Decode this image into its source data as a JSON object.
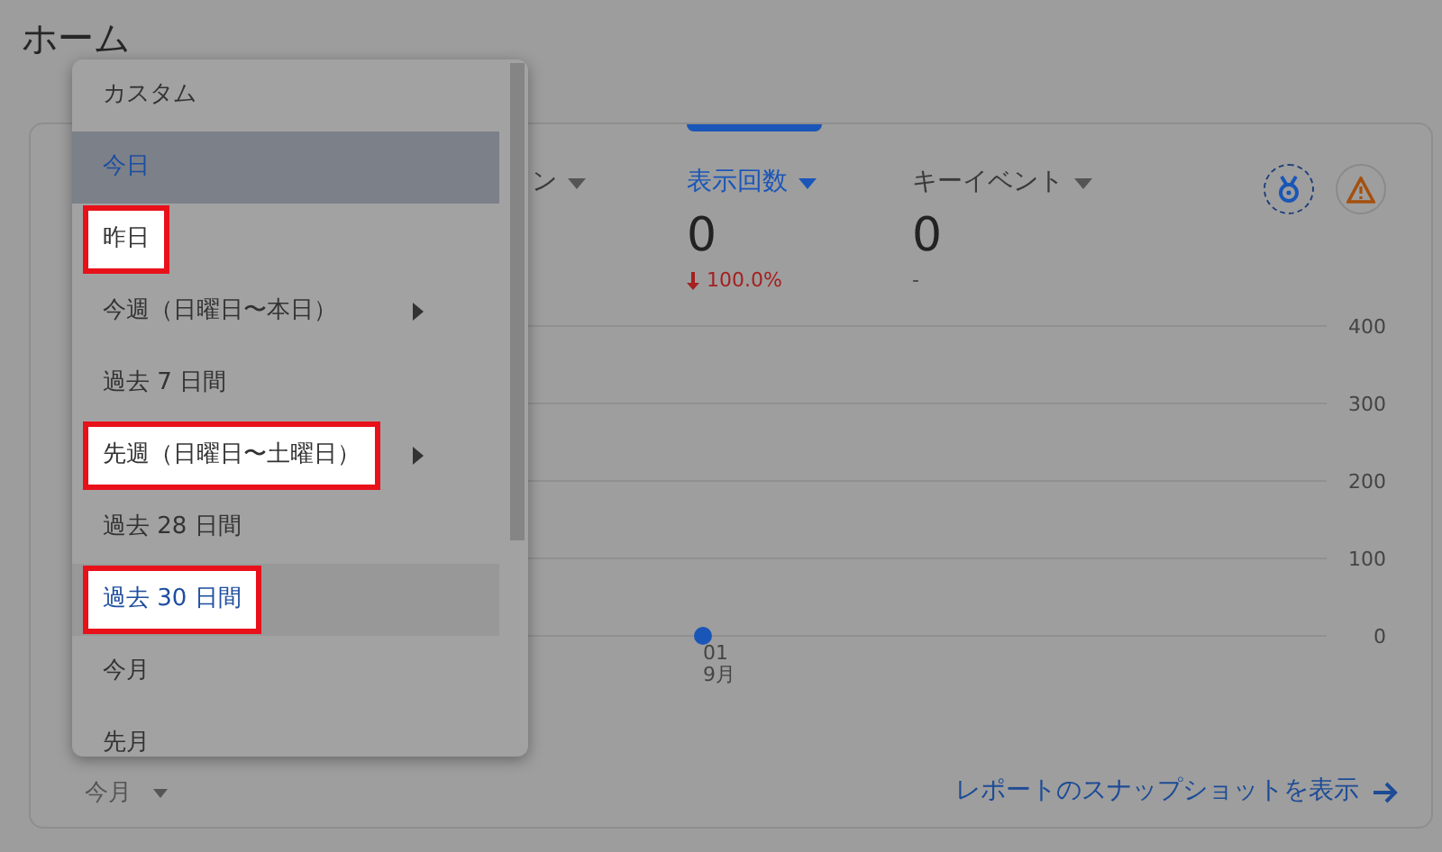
{
  "page": {
    "title": "ホーム"
  },
  "metrics": [
    {
      "label": "ン",
      "selected": false
    },
    {
      "label": "表示回数",
      "selected": true,
      "value": "0",
      "change": "100.0%",
      "decreased": true
    },
    {
      "label": "キーイベント",
      "selected": false,
      "value": "0",
      "change": "-",
      "decreased": false
    }
  ],
  "chart_data": {
    "type": "line",
    "categories": [
      "01\n9月"
    ],
    "series": [
      {
        "color": "#1a56b8",
        "marker": "circle",
        "values": [
          0
        ]
      }
    ],
    "ylim": [
      0,
      400
    ],
    "yticks": [
      400,
      300,
      200,
      100,
      0
    ],
    "grid": true
  },
  "period_select": {
    "value": "今月"
  },
  "report_link": {
    "label": "レポートのスナップショットを表示"
  },
  "menu": {
    "items": [
      {
        "label": "カスタム",
        "selected": false,
        "hovered": false,
        "highlighted": false,
        "submenu": false
      },
      {
        "label": "今日",
        "selected": true,
        "hovered": false,
        "highlighted": false,
        "submenu": false
      },
      {
        "label": "昨日",
        "selected": false,
        "hovered": false,
        "highlighted": true,
        "submenu": false
      },
      {
        "label": "今週（日曜日〜本日）",
        "selected": false,
        "hovered": false,
        "highlighted": false,
        "submenu": true
      },
      {
        "label": "過去 7 日間",
        "selected": false,
        "hovered": false,
        "highlighted": false,
        "submenu": false
      },
      {
        "label": "先週（日曜日〜土曜日）",
        "selected": false,
        "hovered": false,
        "highlighted": true,
        "submenu": true
      },
      {
        "label": "過去 28 日間",
        "selected": false,
        "hovered": false,
        "highlighted": false,
        "submenu": false
      },
      {
        "label": "過去 30 日間",
        "selected": false,
        "hovered": true,
        "highlighted": true,
        "submenu": false
      },
      {
        "label": "今月",
        "selected": false,
        "hovered": false,
        "highlighted": false,
        "submenu": false
      },
      {
        "label": "先月",
        "selected": false,
        "hovered": false,
        "highlighted": false,
        "submenu": false
      }
    ]
  }
}
